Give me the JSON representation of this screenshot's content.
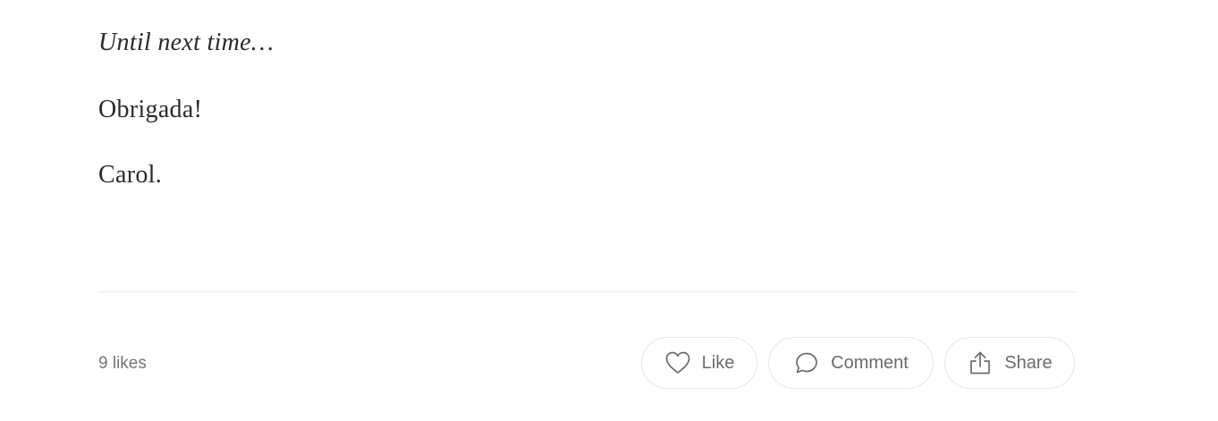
{
  "article": {
    "paragraphs": [
      "Until next time…",
      "Obrigada!",
      "Carol."
    ]
  },
  "footer": {
    "likes_text": "9 likes",
    "actions": {
      "like": {
        "label": "Like",
        "icon": "heart-icon"
      },
      "comment": {
        "label": "Comment",
        "icon": "comment-bubble-icon"
      },
      "share": {
        "label": "Share",
        "icon": "share-upload-icon"
      }
    }
  },
  "colors": {
    "text": "#2b2b2b",
    "muted": "#6b6b6b",
    "border": "#e6e6e6",
    "background": "#ffffff"
  }
}
